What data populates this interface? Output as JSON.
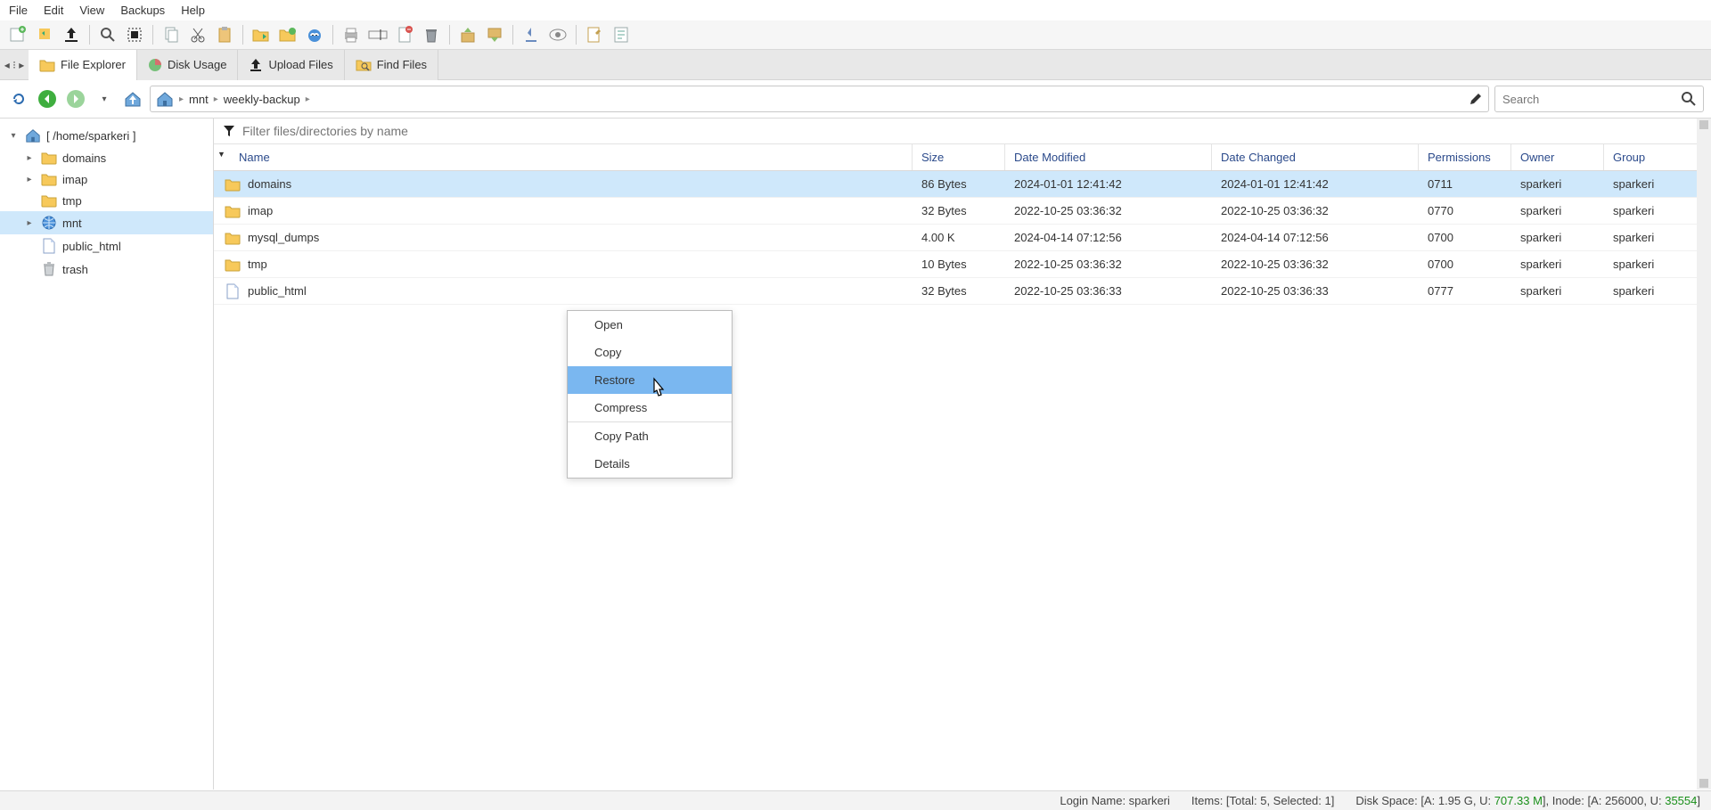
{
  "menu": [
    "File",
    "Edit",
    "View",
    "Backups",
    "Help"
  ],
  "tabs": [
    {
      "icon": "folder",
      "label": "File Explorer",
      "active": true
    },
    {
      "icon": "pie",
      "label": "Disk Usage"
    },
    {
      "icon": "upload",
      "label": "Upload Files"
    },
    {
      "icon": "search-folder",
      "label": "Find Files"
    }
  ],
  "breadcrumb": [
    "mnt",
    "weekly-backup"
  ],
  "search_placeholder": "Search",
  "filter_placeholder": "Filter files/directories by name",
  "tree": {
    "root": "[ /home/sparkeri ]",
    "items": [
      {
        "label": "domains",
        "icon": "folder",
        "caret": ">"
      },
      {
        "label": "imap",
        "icon": "folder",
        "caret": ">"
      },
      {
        "label": "tmp",
        "icon": "folder",
        "caret": ""
      },
      {
        "label": "mnt",
        "icon": "globe",
        "caret": ">",
        "selected": true
      },
      {
        "label": "public_html",
        "icon": "doc",
        "caret": ""
      },
      {
        "label": "trash",
        "icon": "trash",
        "caret": ""
      }
    ]
  },
  "columns": [
    "Name",
    "Size",
    "Date Modified",
    "Date Changed",
    "Permissions",
    "Owner",
    "Group"
  ],
  "rows": [
    {
      "name": "domains",
      "icon": "folder",
      "size": "86 Bytes",
      "mod": "2024-01-01 12:41:42",
      "chg": "2024-01-01 12:41:42",
      "perm": "0711",
      "own": "sparkeri",
      "grp": "sparkeri",
      "selected": true
    },
    {
      "name": "imap",
      "icon": "folder",
      "size": "32 Bytes",
      "mod": "2022-10-25 03:36:32",
      "chg": "2022-10-25 03:36:32",
      "perm": "0770",
      "own": "sparkeri",
      "grp": "sparkeri"
    },
    {
      "name": "mysql_dumps",
      "icon": "folder",
      "size": "4.00 K",
      "mod": "2024-04-14 07:12:56",
      "chg": "2024-04-14 07:12:56",
      "perm": "0700",
      "own": "sparkeri",
      "grp": "sparkeri"
    },
    {
      "name": "tmp",
      "icon": "folder",
      "size": "10 Bytes",
      "mod": "2022-10-25 03:36:32",
      "chg": "2022-10-25 03:36:32",
      "perm": "0700",
      "own": "sparkeri",
      "grp": "sparkeri"
    },
    {
      "name": "public_html",
      "icon": "doc",
      "size": "32 Bytes",
      "mod": "2022-10-25 03:36:33",
      "chg": "2022-10-25 03:36:33",
      "perm": "0777",
      "own": "sparkeri",
      "grp": "sparkeri"
    }
  ],
  "context_menu": [
    "Open",
    "Copy",
    "Restore",
    "Compress",
    "Copy Path",
    "Details"
  ],
  "context_highlight": "Restore",
  "status": {
    "login": "Login Name: sparkeri",
    "items_prefix": "Items: [Total: ",
    "items_total": "5",
    "items_mid": ", Selected: ",
    "items_sel": "1",
    "items_suffix": "]",
    "disk_prefix": "Disk Space: [A: 1.95 G, U: ",
    "disk_used": "707.33 M",
    "disk_mid": "], Inode: [A: 256000, U: ",
    "inode_used": "35554",
    "disk_suffix": "]"
  },
  "icons": {
    "folder": "<svg width='18' height='16' viewBox='0 0 18 16'><path fill='#f7c95b' stroke='#caa23a' d='M1 3h5l2 2h9v9a1 1 0 0 1-1 1H2a1 1 0 0 1-1-1z'/></svg>",
    "globe": "<svg width='18' height='18' viewBox='0 0 18 18'><circle cx='9' cy='9' r='7' fill='#4a90d9' stroke='#2c6bb0'/><path fill='none' stroke='#cfe6fa' d='M2 9h14M9 2v14M4 4c3 3 7 3 10 0M4 14c3-3 7-3 10 0'/></svg>",
    "doc": "<svg width='16' height='18' viewBox='0 0 16 18'><path fill='#fff' stroke='#8aa0c8' d='M2 1h8l4 4v12H2z'/><path fill='#c9d8f0' d='M10 1v4h4z'/></svg>",
    "trash": "<svg width='16' height='18' viewBox='0 0 16 18'><path fill='#cfd3d6' stroke='#8f9498' d='M3 5h10l-1 11H4z'/><rect x='2' y='3' width='12' height='2' fill='#b9bdc0'/><rect x='6' y='1' width='4' height='2' fill='#b9bdc0'/></svg>",
    "home": "<svg width='20' height='18' viewBox='0 0 20 18'><path fill='#6fa8dc' stroke='#3d6fa0' d='M2 9 10 2l8 7v8H2z'/><rect x='8' y='11' width='4' height='6' fill='#3d6fa0'/></svg>",
    "pie": "<svg width='16' height='16' viewBox='0 0 16 16'><circle cx='8' cy='8' r='7' fill='#77c07a'/><path fill='#d86f6f' d='M8 8V1a7 7 0 0 1 7 7z'/></svg>",
    "upload": "<svg width='16' height='16' viewBox='0 0 16 16'><path fill='#222' d='M8 1 3 7h3v5h4V7h3z'/><rect x='2' y='13' width='12' height='2' fill='#222'/></svg>",
    "search-folder": "<svg width='18' height='16' viewBox='0 0 18 16'><path fill='#f7c95b' stroke='#caa23a' d='M1 3h5l2 2h9v9H1z'/><circle cx='10' cy='9' r='3' fill='none' stroke='#555'/><line x1='12' y1='11' x2='15' y2='14' stroke='#555' stroke-width='1.5'/></svg>",
    "reload": "<svg width='18' height='18' viewBox='0 0 18 18'><path fill='none' stroke='#2c6bb0' stroke-width='2' d='M4 9a5 5 0 1 1 2 4'/><path fill='#2c6bb0' d='M3 11l3 3 1-5z'/></svg>",
    "back": "<svg width='22' height='22' viewBox='0 0 22 22'><circle cx='11' cy='11' r='10' fill='#3fae3f'/><path fill='#fff' d='M13 6l-5 5 5 5z'/></svg>",
    "fwd": "<svg width='22' height='22' viewBox='0 0 22 22'><circle cx='11' cy='11' r='10' fill='#9bd49b'/><path fill='#fff' d='M9 6l5 5-5 5z'/></svg>",
    "up": "<svg width='20' height='18' viewBox='0 0 20 18'><path fill='#6fa8dc' stroke='#3d6fa0' d='M2 9 10 2l8 7v8H2z'/><path fill='#fff' d='M10 5 6 10h3v5h2v-5h3z'/></svg>",
    "pencil": "<svg width='16' height='16' viewBox='0 0 16 16'><path fill='#333' d='M2 14l1-4 8-8 3 3-8 8z'/></svg>",
    "search": "<svg width='16' height='16' viewBox='0 0 16 16'><circle cx='6' cy='6' r='5' fill='none' stroke='#444' stroke-width='2'/><line x1='10' y1='10' x2='15' y2='15' stroke='#444' stroke-width='2'/></svg>",
    "filter": "<svg width='14' height='14' viewBox='0 0 14 14'><path fill='#222' d='M1 1h12L8 7v6l-2-1V7z'/></svg>"
  }
}
